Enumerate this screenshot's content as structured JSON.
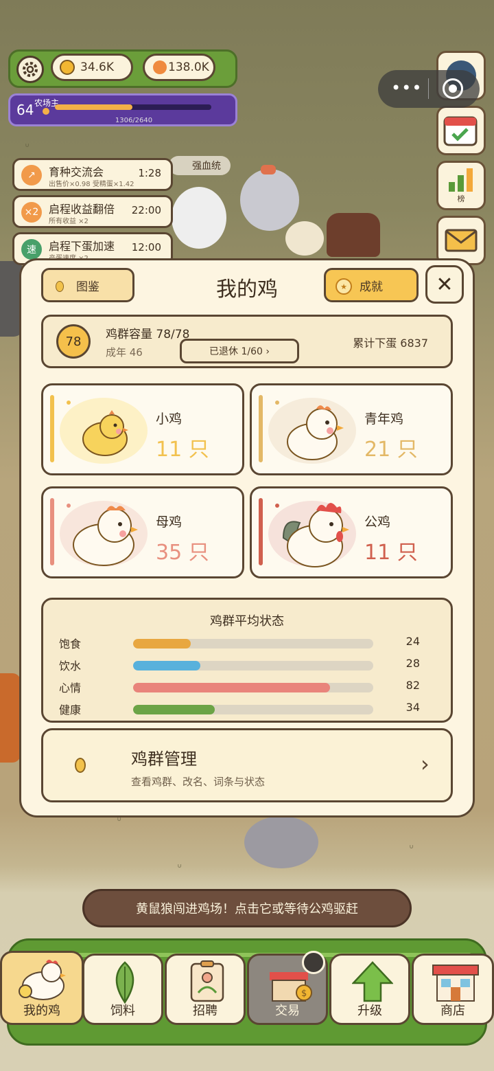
{
  "hud": {
    "coins": "34.6K",
    "gems": "138.0K",
    "level": "64",
    "level_title": "农场主",
    "xp_text": "1306/2640",
    "xp_progress": 0.495
  },
  "side_buttons": {
    "rank_label": "榜"
  },
  "buffs": [
    {
      "icon": "↗",
      "title": "育种交流会",
      "sub": "出售价×0.98 受精蛋×1.42",
      "time": "1:28"
    },
    {
      "icon": "×2",
      "title": "启程收益翻倍",
      "sub": "所有收益 ×2",
      "time": "22:00"
    },
    {
      "icon": "速",
      "title": "启程下蛋加速",
      "sub": "产蛋速度 ×2",
      "time": "12:00"
    }
  ],
  "blood_tag": "强血统",
  "panel": {
    "tujian_label": "图鉴",
    "title": "我的鸡",
    "achievement_label": "成就",
    "close_label": "✕",
    "capacity_num": "78",
    "capacity_title": "鸡群容量 78/78",
    "adult_text": "成年 46",
    "retired_text": "已退休 1/60 ›",
    "eggs_text": "累计下蛋 6837",
    "cards": [
      {
        "name": "小鸡",
        "count": "11 只",
        "color": "#f2c14e"
      },
      {
        "name": "青年鸡",
        "count": "21 只",
        "color": "#e3b866"
      },
      {
        "name": "母鸡",
        "count": "35 只",
        "color": "#e8907f"
      },
      {
        "name": "公鸡",
        "count": "11 只",
        "color": "#d0604e"
      }
    ],
    "status_title": "鸡群平均状态",
    "status": [
      {
        "label": "饱食",
        "value": "24",
        "ratio": 0.24,
        "color": "#e8a740"
      },
      {
        "label": "饮水",
        "value": "28",
        "ratio": 0.28,
        "color": "#58b1dc"
      },
      {
        "label": "心情",
        "value": "82",
        "ratio": 0.82,
        "color": "#e9847b"
      },
      {
        "label": "健康",
        "value": "34",
        "ratio": 0.34,
        "color": "#6ca446"
      }
    ],
    "manage_title": "鸡群管理",
    "manage_sub": "查看鸡群、改名、词条与状态",
    "manage_arrow": "›"
  },
  "toast": "黄鼠狼闯进鸡场！点击它或等待公鸡驱赶",
  "nav": [
    {
      "label": "我的鸡"
    },
    {
      "label": "饲料"
    },
    {
      "label": "招聘"
    },
    {
      "label": "交易"
    },
    {
      "label": "升级"
    },
    {
      "label": "商店"
    }
  ]
}
